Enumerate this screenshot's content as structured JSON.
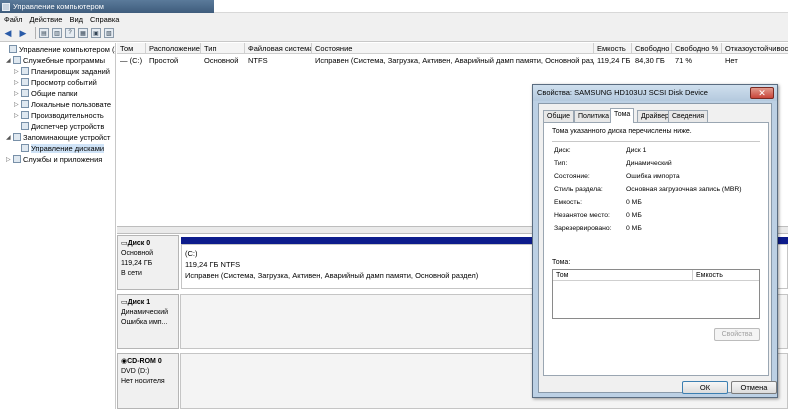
{
  "window": {
    "title": "Управление компьютером"
  },
  "menu": [
    "Файл",
    "Действие",
    "Вид",
    "Справка"
  ],
  "tree": [
    {
      "label": "Управление компьютером (л",
      "indent": 0,
      "expander": "",
      "selected": false
    },
    {
      "label": "Служебные программы",
      "indent": 1,
      "expander": "◢",
      "selected": false
    },
    {
      "label": "Планировщик заданий",
      "indent": 2,
      "expander": "▷",
      "selected": false
    },
    {
      "label": "Просмотр событий",
      "indent": 2,
      "expander": "▷",
      "selected": false
    },
    {
      "label": "Общие папки",
      "indent": 2,
      "expander": "▷",
      "selected": false
    },
    {
      "label": "Локальные пользовате",
      "indent": 2,
      "expander": "▷",
      "selected": false
    },
    {
      "label": "Производительность",
      "indent": 2,
      "expander": "▷",
      "selected": false
    },
    {
      "label": "Диспетчер устройств",
      "indent": 2,
      "expander": "",
      "selected": false
    },
    {
      "label": "Запоминающие устройст",
      "indent": 1,
      "expander": "◢",
      "selected": false
    },
    {
      "label": "Управление дисками",
      "indent": 2,
      "expander": "",
      "selected": true
    },
    {
      "label": "Службы и приложения",
      "indent": 1,
      "expander": "▷",
      "selected": false
    }
  ],
  "volumes": {
    "headers": [
      "Том",
      "Расположение",
      "Тип",
      "Файловая система",
      "Состояние",
      "Емкость",
      "Свободно",
      "Свободно %",
      "Отказоустойчивос"
    ],
    "rows": [
      [
        "(C:)",
        "Простой",
        "Основной",
        "NTFS",
        "Исправен (Система, Загрузка, Активен, Аварийный дамп памяти, Основной раздел)",
        "119,24 ГБ",
        "84,30 ГБ",
        "71 %",
        "Нет"
      ]
    ]
  },
  "disks": [
    {
      "name": "Диск 0",
      "lines": [
        "Основной",
        "119,24 ГБ",
        "В сети"
      ]
    },
    {
      "name": "Диск 1",
      "lines": [
        "Динамический",
        "",
        "Ошибка имп..."
      ]
    },
    {
      "name": "CD-ROM 0",
      "lines": [
        "DVD (D:)",
        "",
        "Нет носителя"
      ]
    }
  ],
  "partition": {
    "name": "(C:)",
    "size": "119,24 ГБ NTFS",
    "status": "Исправен (Система, Загрузка, Активен, Аварийный дамп памяти, Основной раздел)"
  },
  "dialog": {
    "title": "Свойства: SAMSUNG HD103UJ SCSI Disk Device",
    "close": "✕",
    "tabs": [
      "Общие",
      "Политика",
      "Тома",
      "Драйвер",
      "Сведения"
    ],
    "active_tab": "Тома",
    "description": "Тома указанного диска перечислены ниже.",
    "props": [
      {
        "label": "Диск:",
        "value": "Диск 1"
      },
      {
        "label": "Тип:",
        "value": "Динамический"
      },
      {
        "label": "Состояние:",
        "value": "Ошибка импорта"
      },
      {
        "label": "Стиль раздела:",
        "value": "Основная загрузочная запись (MBR)"
      },
      {
        "label": "Емкость:",
        "value": "0 МБ"
      },
      {
        "label": "Незанятое место:",
        "value": "0 МБ"
      },
      {
        "label": "Зарезервировано:",
        "value": "0 МБ"
      }
    ],
    "volumes_label": "Тома:",
    "volume_list_headers": [
      "Том",
      "Емкость"
    ],
    "properties_button": "Свойства",
    "ok_button": "ОК",
    "cancel_button": "Отмена"
  }
}
